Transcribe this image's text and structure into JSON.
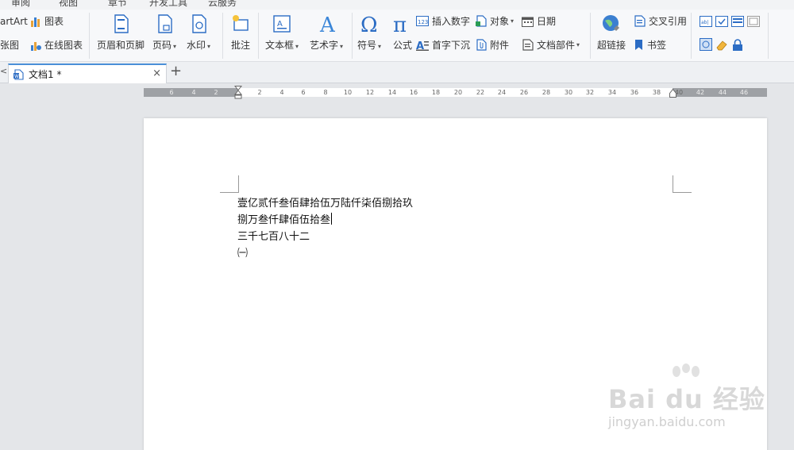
{
  "menu": {
    "items": [
      "审阅",
      "视图",
      "章节",
      "开发工具",
      "云服务"
    ]
  },
  "ribbon": {
    "wordart": "artArt",
    "chart": "图表",
    "screenshot": "张图",
    "online_chart": "在线图表",
    "header_footer": "页眉和页脚",
    "page_number": "页码",
    "watermark": "水印",
    "comment": "批注",
    "textbox": "文本框",
    "art_text": "艺术字",
    "symbol": "符号",
    "formula": "公式",
    "insert_number": "插入数字",
    "object": "对象",
    "date": "日期",
    "drop_cap": "首字下沉",
    "attachment": "附件",
    "doc_parts": "文档部件",
    "hyperlink": "超链接",
    "cross_ref": "交叉引用",
    "bookmark": "书签",
    "caret": "▾"
  },
  "tabs": {
    "doc_tab": "文档1 *",
    "close": "×",
    "new": "+",
    "left_arrow": "<"
  },
  "ruler": {
    "ticks_left": [
      "6",
      "4",
      "2"
    ],
    "ticks_main": [
      "2",
      "4",
      "6",
      "8",
      "10",
      "12",
      "14",
      "16",
      "18",
      "20",
      "22",
      "24",
      "26",
      "28",
      "30",
      "32",
      "34",
      "36",
      "38",
      "40"
    ],
    "ticks_right": [
      "42",
      "44",
      "46"
    ]
  },
  "document": {
    "lines": [
      "壹亿贰仟叁佰肆拾伍万陆仟柒佰捌拾玖",
      "捌万叁仟肆佰伍拾叁",
      "三千七百八十二",
      "㈠"
    ]
  },
  "watermark": {
    "brand": "Bai du 经验",
    "url": "jingyan.baidu.com"
  },
  "colors": {
    "accent": "#4a8fd8",
    "icon_blue": "#2b6cc4"
  }
}
